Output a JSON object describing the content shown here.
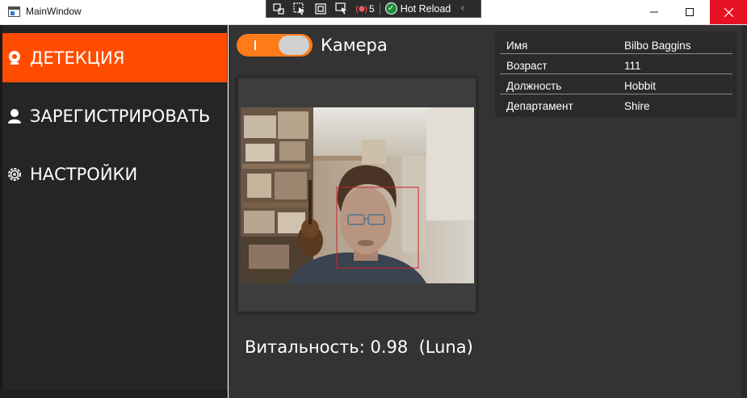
{
  "window": {
    "title": "MainWindow"
  },
  "dev_toolbar": {
    "binding_failures_count": "5",
    "hot_reload_label": "Hot Reload"
  },
  "sidebar": {
    "items": [
      {
        "label": "ДЕТЕКЦИЯ",
        "icon": "webcam-icon",
        "active": true
      },
      {
        "label": "ЗАРЕГИСТРИРОВАТЬ",
        "icon": "user-icon",
        "active": false
      },
      {
        "label": "НАСТРОЙКИ",
        "icon": "gear-icon",
        "active": false
      }
    ]
  },
  "camera": {
    "label": "Камера",
    "toggle_on": true
  },
  "person": {
    "rows": [
      {
        "key": "Имя",
        "value": "Bilbo Baggins"
      },
      {
        "key": "Возраст",
        "value": "111"
      },
      {
        "key": "Должность",
        "value": "Hobbit"
      },
      {
        "key": "Департамент",
        "value": "Shire"
      }
    ]
  },
  "vitality": {
    "label": "Витальность:",
    "value": "0.98",
    "source": "(Luna)"
  },
  "colors": {
    "accent": "#ff4c00",
    "toggle": "#ff7b1a",
    "sidebar_bg": "#252526",
    "main_bg": "#333333",
    "close_button": "#e81123",
    "face_box": "#d0202a"
  }
}
